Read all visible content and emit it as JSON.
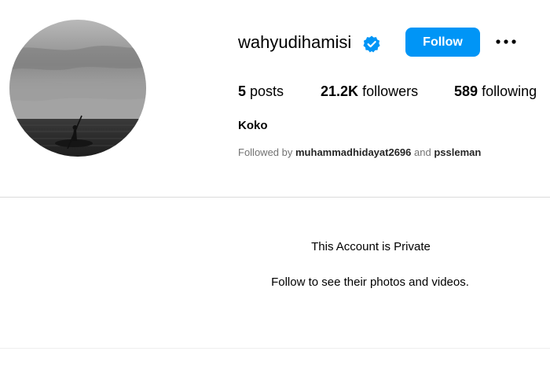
{
  "profile": {
    "username": "wahyudihamisi",
    "verified": true,
    "follow_label": "Follow",
    "more_icon": "more-horizontal-icon",
    "avatar_description_icon": "kayak-at-sea-avatar",
    "full_name": "Koko"
  },
  "stats": {
    "posts_count": "5",
    "posts_label": "posts",
    "followers_count": "21.2K",
    "followers_label": "followers",
    "following_count": "589",
    "following_label": "following"
  },
  "followed_by": {
    "prefix": "Followed by",
    "user1": "muhammadhidayat2696",
    "conjunction": "and",
    "user2": "pssleman"
  },
  "private_notice": {
    "title": "This Account is Private",
    "subtitle": "Follow to see their photos and videos."
  },
  "colors": {
    "accent": "#0095f6",
    "verified_badge": "#0095f6",
    "muted_text": "#737373",
    "divider": "#dbdbdb"
  }
}
